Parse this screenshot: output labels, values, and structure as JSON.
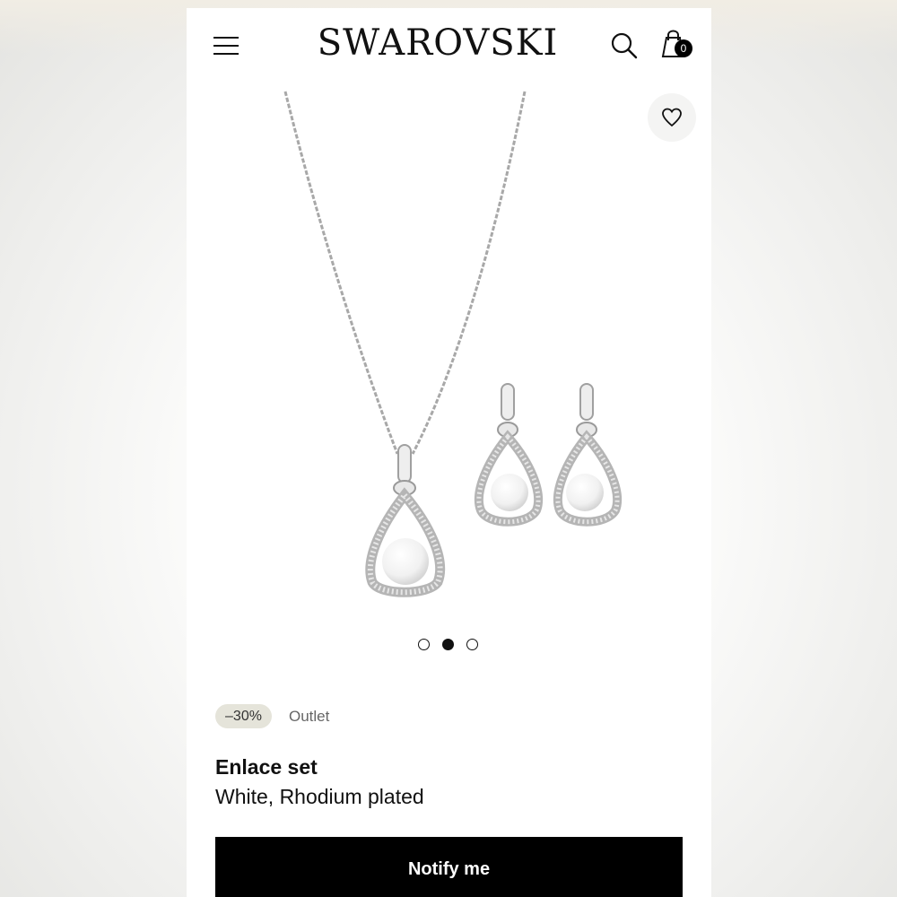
{
  "header": {
    "brand": "SWAROVSKI",
    "bag_count": "0",
    "menu_icon": "hamburger-menu-icon",
    "search_icon": "search-icon",
    "bag_icon": "shopping-bag-icon"
  },
  "gallery": {
    "wishlist_icon": "heart-icon",
    "slide_count": 3,
    "active_slide": 2
  },
  "product": {
    "discount": "–30%",
    "tag": "Outlet",
    "name": "Enlace set",
    "variant": "White, Rhodium plated"
  },
  "cta": {
    "label": "Notify me",
    "color": "#000000"
  }
}
